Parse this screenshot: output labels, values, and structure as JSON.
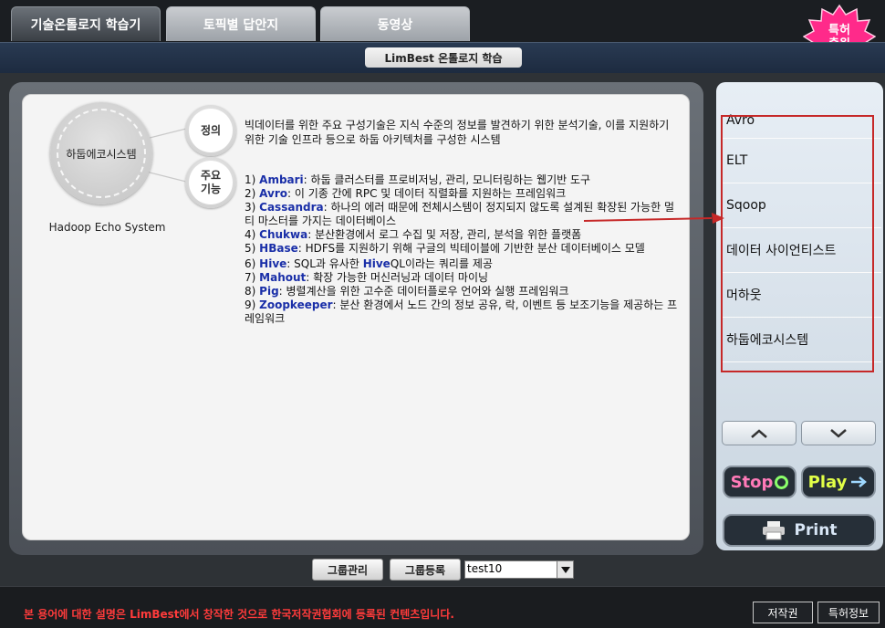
{
  "tabs": [
    {
      "label": "기술온톨로지 학습기",
      "active": true
    },
    {
      "label": "토픽별 답안지",
      "active": false
    },
    {
      "label": "동영상",
      "active": false
    }
  ],
  "badge": {
    "line1": "특허",
    "line2": "출원",
    "color": "#ff2a8a"
  },
  "subtitle": "LimBest 온톨로지 학습",
  "concept": {
    "name": "하둡에코시스템",
    "english": "Hadoop Echo System",
    "definition_label": "정의",
    "features_label_1": "주요",
    "features_label_2": "기능",
    "definition": "빅데이터를 위한 주요 구성기술은 지식 수준의 정보를 발견하기 위한 분석기술, 이를 지원하기 위한 기술 인프라 등으로 하둡 아키텍처를 구성한 시스템",
    "features": [
      {
        "num": "1)",
        "name": "Ambari",
        "desc": ": 하둡 클러스터를 프로비저닝, 관리, 모니터링하는 웹기반 도구"
      },
      {
        "num": "2)",
        "name": "Avro",
        "desc": ": 이 기종 간에 RPC 및 데이터 직렬화를 지원하는 프레임워크"
      },
      {
        "num": "3)",
        "name": "Cassandra",
        "desc": ": 하나의 에러 때문에 전체시스템이 정지되지 않도록 설계된 확장된 가능한 멀티 마스터를 가지는 데이터베이스"
      },
      {
        "num": "4)",
        "name": "Chukwa",
        "desc": ": 분산환경에서 로그 수집 및 저장, 관리, 분석을 위한 플랫폼"
      },
      {
        "num": "5)",
        "name": "HBase",
        "desc": ": HDFS를 지원하기 위해 구글의 빅테이블에 기반한 분산 데이터베이스 모델"
      },
      {
        "num": "6)",
        "name": "Hive",
        "desc_pre": ": SQL과 유사한 ",
        "name2": "Hive",
        "desc": "QL이라는 쿼리를 제공"
      },
      {
        "num": "7)",
        "name": "Mahout",
        "desc": ": 확장 가능한 머신러닝과 데이터 마이닝"
      },
      {
        "num": "8)",
        "name": "Pig",
        "desc": ": 병렬계산을 위한 고수준 데이터플로우 언어와 실행 프레임워크"
      },
      {
        "num": "9)",
        "name": "Zoopkeeper",
        "desc": ": 분산 환경에서 노드 간의 정보 공유, 락, 이벤트 등 보조기능을 제공하는 프레임워크"
      }
    ]
  },
  "side_words": [
    "Avro",
    "ELT",
    "Sqoop",
    "데이터 사이언티스트",
    "머하웃",
    "하둡에코시스템"
  ],
  "controls": {
    "stop": "Stop",
    "play": "Play",
    "print": "Print"
  },
  "bottom": {
    "group_manage": "그룹관리",
    "group_register": "그룹등록",
    "select_value": "test10"
  },
  "footer": {
    "note": "본 용어에 대한 설명은 LimBest에서 창작한 것으로 한국저작권협회에 등록된 컨텐츠입니다.",
    "copyright_btn": "저작권",
    "patent_btn": "특허정보"
  },
  "colors": {
    "keyword": "#1a2fa8",
    "highlight": "#c62828",
    "note": "#ff3b3b"
  }
}
